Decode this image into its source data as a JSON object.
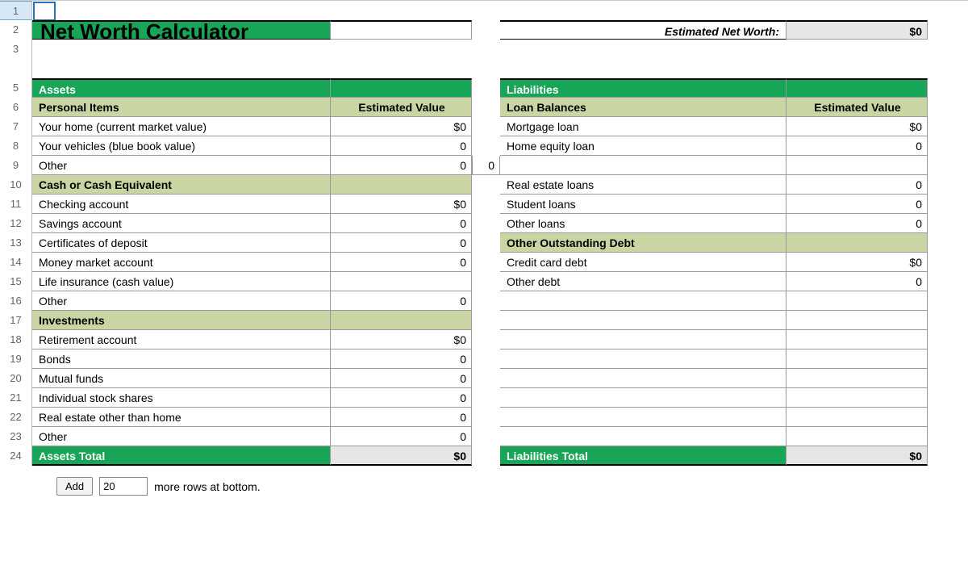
{
  "title": "Net Worth Calculator",
  "netWorth": {
    "label": "Estimated Net Worth:",
    "value": "$0"
  },
  "assets": {
    "header": "Assets",
    "total": {
      "label": "Assets Total",
      "value": "$0"
    },
    "sections": [
      {
        "name": "Personal Items",
        "valueHeader": "Estimated Value",
        "items": [
          {
            "label": "Your home (current market value)",
            "value": "$0"
          },
          {
            "label": "Your vehicles (blue book value)",
            "value": "0"
          },
          {
            "label": "Other",
            "value": "0"
          }
        ]
      },
      {
        "name": "Cash or Cash Equivalent",
        "items": [
          {
            "label": "Checking account",
            "value": "$0"
          },
          {
            "label": "Savings account",
            "value": "0"
          },
          {
            "label": "Certificates of deposit",
            "value": "0"
          },
          {
            "label": "Money market account",
            "value": "0"
          },
          {
            "label": "Life insurance (cash value)",
            "value": ""
          },
          {
            "label": "Other",
            "value": "0"
          }
        ]
      },
      {
        "name": "Investments",
        "items": [
          {
            "label": "Retirement account",
            "value": "$0"
          },
          {
            "label": "Bonds",
            "value": "0"
          },
          {
            "label": "Mutual funds",
            "value": "0"
          },
          {
            "label": "Individual stock shares",
            "value": "0"
          },
          {
            "label": "Real estate other than home",
            "value": "0"
          },
          {
            "label": "Other",
            "value": "0"
          }
        ]
      }
    ]
  },
  "liabilities": {
    "header": "Liabilities",
    "total": {
      "label": "Liabilities Total",
      "value": "$0"
    },
    "sections": [
      {
        "name": "Loan Balances",
        "valueHeader": "Estimated Value",
        "items": [
          {
            "label": "Mortgage loan",
            "value": "$0"
          },
          {
            "label": "Home equity loan",
            "value": "0"
          },
          {
            "label": "",
            "value": ""
          },
          {
            "label": "Real estate loans",
            "value": "0"
          },
          {
            "label": "Student loans",
            "value": "0"
          },
          {
            "label": "Other loans",
            "value": "0"
          }
        ]
      },
      {
        "name": "Other Outstanding Debt",
        "items": [
          {
            "label": "Credit card debt",
            "value": "$0"
          },
          {
            "label": "Other debt",
            "value": "0"
          }
        ]
      }
    ]
  },
  "midColExtra": "0",
  "addRow": {
    "button": "Add",
    "count": "20",
    "suffix": "more rows at bottom."
  },
  "rowNumbers": [
    "1",
    "2",
    "3",
    "",
    "5",
    "6",
    "7",
    "8",
    "9",
    "10",
    "11",
    "12",
    "13",
    "14",
    "15",
    "16",
    "17",
    "18",
    "19",
    "20",
    "21",
    "22",
    "23",
    "24"
  ]
}
